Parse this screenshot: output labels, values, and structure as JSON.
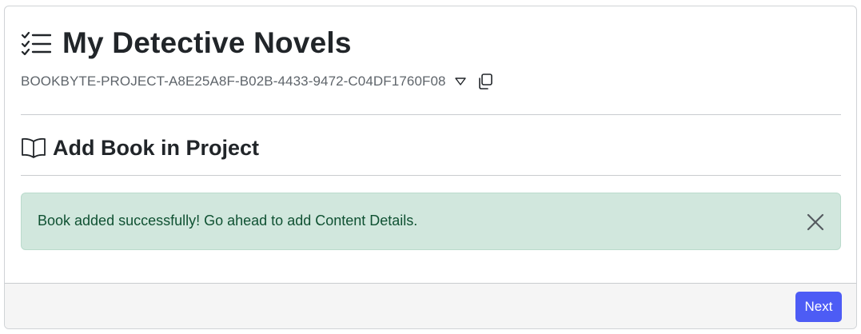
{
  "header": {
    "title": "My Detective Novels",
    "title_icon": "list-check-icon",
    "project_id": "BOOKBYTE-PROJECT-A8E25A8F-B02B-4433-9472-C04DF1760F08",
    "dropdown_icon": "caret-down-icon",
    "copy_icon": "copy-icon"
  },
  "section": {
    "title": "Add Book in Project",
    "icon": "book-icon"
  },
  "alert": {
    "message": "Book added successfully! Go ahead to add Content Details.",
    "close_icon": "close-icon",
    "bg_color": "#d1e7dd",
    "text_color": "#0f5132"
  },
  "footer": {
    "next_label": "Next",
    "accent_color": "#4d5cf5"
  }
}
